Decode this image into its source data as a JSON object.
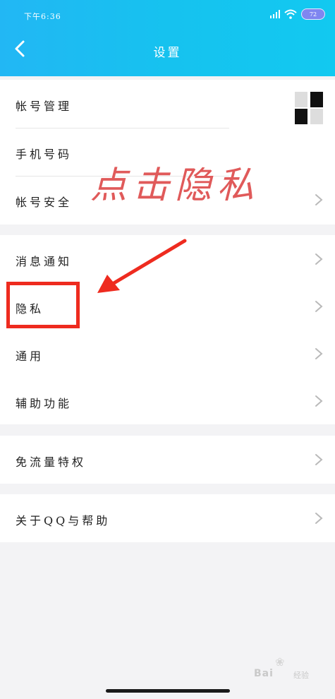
{
  "status_bar": {
    "time": "下午6:36",
    "battery": "72"
  },
  "header": {
    "title": "设置"
  },
  "groups": [
    {
      "items": [
        {
          "label": "帐号管理"
        },
        {
          "label": "手机号码"
        },
        {
          "label": "帐号安全"
        }
      ]
    },
    {
      "items": [
        {
          "label": "消息通知"
        },
        {
          "label": "隐私"
        },
        {
          "label": "通用"
        },
        {
          "label": "辅助功能"
        }
      ]
    },
    {
      "items": [
        {
          "label": "免流量特权"
        }
      ]
    },
    {
      "items": [
        {
          "label": "关于QQ与帮助"
        }
      ]
    }
  ],
  "annotation": {
    "text": "点击隐私",
    "color": "#e05a5a",
    "highlight_color": "#ee2b1f"
  },
  "watermark": {
    "brand": "Bai",
    "suffix": "经验"
  },
  "colors": {
    "header": "#16c2ef",
    "background": "#f3f3f5"
  }
}
